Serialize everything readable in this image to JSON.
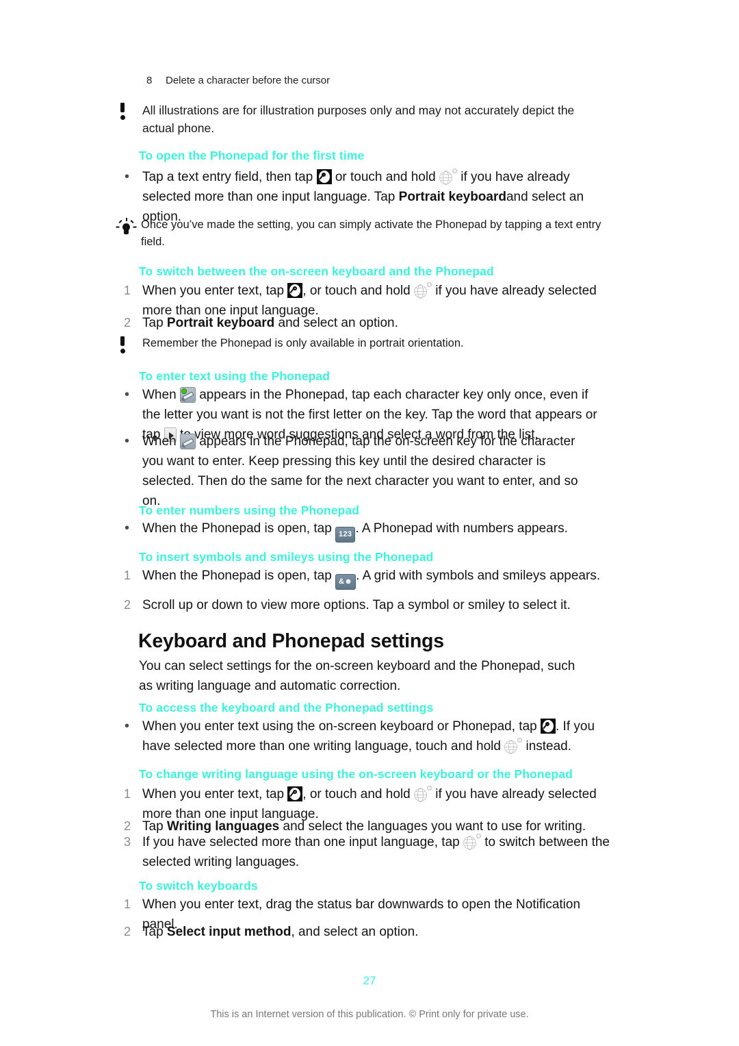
{
  "document": {
    "page_number": "27",
    "footer_note": "This is an Internet version of this publication. © Print only for private use."
  },
  "legend": {
    "number": "8",
    "text": "Delete a character before the cursor"
  },
  "notes": {
    "illustrations_warning": "All illustrations are for illustration purposes only and may not accurately depict the actual phone.",
    "phonepad_tip": "Once you’ve made the setting, you can simply activate the Phonepad by tapping a text entry field.",
    "portrait_warning": "Remember the Phonepad is only available in portrait orientation."
  },
  "sections": {
    "open_phonepad": {
      "heading": "To open the Phonepad for the first time",
      "step1_a": "Tap a text entry field, then tap",
      "step1_b": "or touch and hold",
      "step1_c": "if you have already selected more than one input language. Tap",
      "step1_bold": "Portrait keyboard",
      "step1_d": "and select an option."
    },
    "switch_keyboard_phonepad": {
      "heading": "To switch between the on-screen keyboard and the Phonepad",
      "step1_num": "1",
      "step1_a": "When you enter text, tap",
      "step1_b": ", or touch and hold",
      "step1_c": "if you have already selected more than one input language.",
      "step2_num": "2",
      "step2_a": "Tap",
      "step2_bold": "Portrait keyboard",
      "step2_b": "and select an option."
    },
    "enter_text": {
      "heading": "To enter text using the Phonepad",
      "bullet1_a": "When",
      "bullet1_b": "appears in the Phonepad, tap each character key only once, even if the letter you want is not the first letter on the key. Tap the word that appears or tap",
      "bullet1_c": "to view more word suggestions and select a word from the list.",
      "bullet2_a": "When",
      "bullet2_b": "appears in the Phonepad, tap the on-screen key for the character you want to enter. Keep pressing this key until the desired character is selected. Then do the same for the next character you want to enter, and so on."
    },
    "enter_numbers": {
      "heading": "To enter numbers using the Phonepad",
      "bullet1_a": "When the Phonepad is open, tap",
      "bullet1_icon_label": "123",
      "bullet1_b": ". A Phonepad with numbers appears."
    },
    "insert_symbols": {
      "heading": "To insert symbols and smileys using the Phonepad",
      "step1_num": "1",
      "step1_a": "When the Phonepad is open, tap",
      "step1_icon_label": "&☻",
      "step1_b": ". A grid with symbols and smileys appears.",
      "step2_num": "2",
      "step2_text": "Scroll up or down to view more options. Tap a symbol or smiley to select it."
    },
    "keyboard_settings": {
      "title": "Keyboard and Phonepad settings",
      "intro": "You can select settings for the on-screen keyboard and the Phonepad, such as writing language and automatic correction."
    },
    "access_settings": {
      "heading": "To access the keyboard and the Phonepad settings",
      "bullet1_a": "When you enter text using the on-screen keyboard or Phonepad, tap",
      "bullet1_b": ". If you have selected more than one writing language, touch and hold",
      "bullet1_c": "instead."
    },
    "change_language": {
      "heading": "To change writing language using the on-screen keyboard or the Phonepad",
      "step1_num": "1",
      "step1_a": "When you enter text, tap",
      "step1_b": ", or touch and hold",
      "step1_c": "if you have already selected more than one input language.",
      "step2_num": "2",
      "step2_a": "Tap",
      "step2_bold": "Writing languages",
      "step2_b": "and select the languages you want to use for writing.",
      "step3_num": "3",
      "step3_a": "If you have selected more than one input language, tap",
      "step3_b": "to switch between the selected writing languages."
    },
    "switch_keyboards": {
      "heading": "To switch keyboards",
      "step1_num": "1",
      "step1_text": "When you enter text, drag the status bar downwards to open the Notification panel.",
      "step2_num": "2",
      "step2_a": "Tap",
      "step2_bold": "Select input method",
      "step2_b": ", and select an option."
    }
  },
  "colors": {
    "heading_accent": "#3df2d8",
    "body_text": "#141414",
    "marker_gray": "#8b8b8b",
    "footer_gray": "#777777"
  }
}
